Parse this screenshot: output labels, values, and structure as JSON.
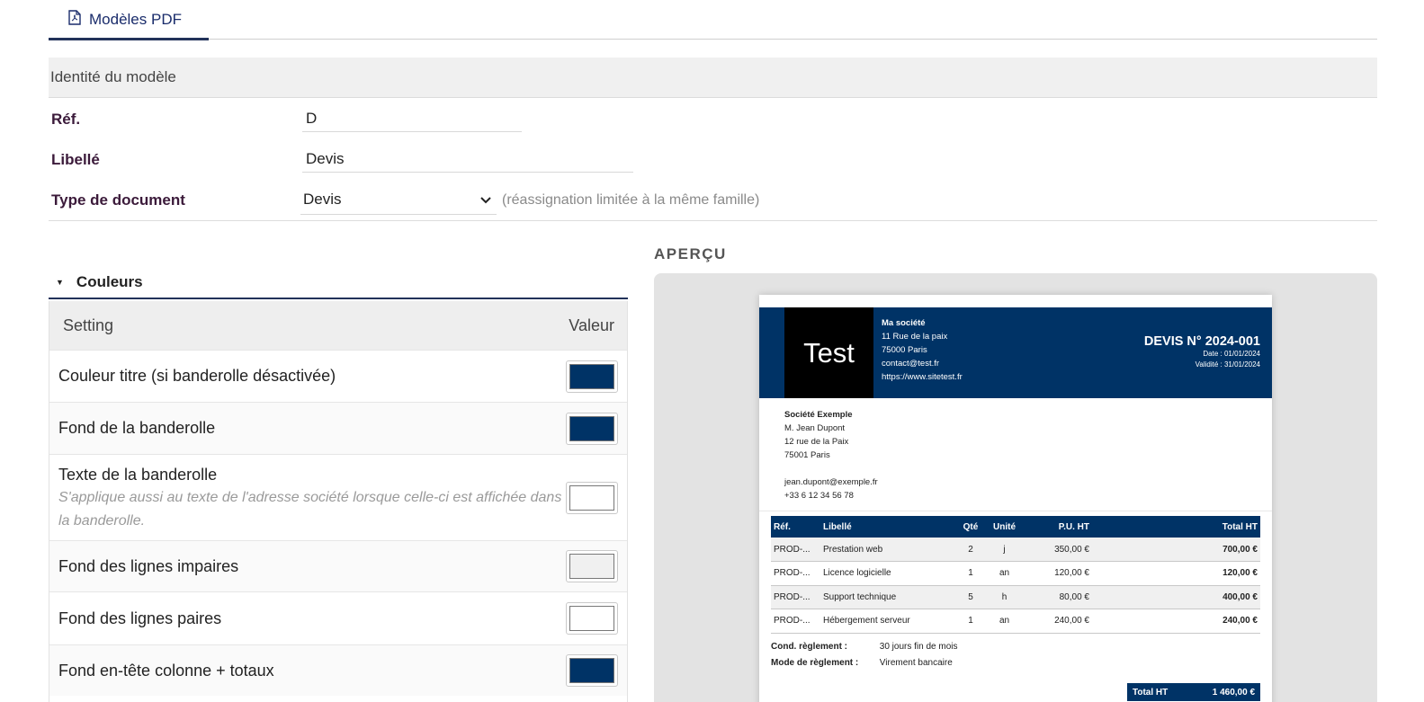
{
  "tabs": [
    {
      "label": "Modèles PDF",
      "icon": "pdf-file-icon",
      "active": true
    }
  ],
  "identity": {
    "title": "Identité du modèle",
    "ref_label": "Réf.",
    "ref_value": "D",
    "libelle_label": "Libellé",
    "libelle_value": "Devis",
    "type_label": "Type de document",
    "type_value": "Devis",
    "type_hint": "(réassignation limitée à la même famille)"
  },
  "colors": {
    "title": "Couleurs",
    "col_setting": "Setting",
    "col_value": "Valeur",
    "rows": [
      {
        "label": "Couleur titre (si banderolle désactivée)",
        "color": "#003366"
      },
      {
        "label": "Fond de la banderolle",
        "color": "#003366"
      },
      {
        "label": "Texte de la banderolle",
        "desc": "S'applique aussi au texte de l'adresse société lorsque celle-ci est affichée dans la banderolle.",
        "color": "#ffffff"
      },
      {
        "label": "Fond des lignes impaires",
        "color": "#f0f0f0"
      },
      {
        "label": "Fond des lignes paires",
        "color": "#ffffff"
      },
      {
        "label": "Fond en-tête colonne + totaux",
        "color": "#003366"
      }
    ]
  },
  "preview": {
    "title": "APERÇU",
    "logo_text": "Test",
    "company": {
      "name": "Ma société",
      "street": "11 Rue de la paix",
      "city": "75000 Paris",
      "email": "contact@test.fr",
      "web": "https://www.sitetest.fr"
    },
    "doc_title": "DEVIS N° 2024-001",
    "doc_date": "Date : 01/01/2024",
    "doc_validity": "Validité : 31/01/2024",
    "client": {
      "company": "Société Exemple",
      "person": "M. Jean Dupont",
      "street": "12 rue de la Paix",
      "city": "75001 Paris",
      "email": "jean.dupont@exemple.fr",
      "phone": "+33 6 12 34 56 78"
    },
    "table": {
      "headers": {
        "ref": "Réf.",
        "label": "Libellé",
        "qty": "Qté",
        "unit": "Unité",
        "pu": "P.U. HT",
        "total": "Total HT"
      },
      "rows": [
        {
          "ref": "PROD-...",
          "label": "Prestation web",
          "qty": "2",
          "unit": "j",
          "pu": "350,00 €",
          "total": "700,00 €"
        },
        {
          "ref": "PROD-...",
          "label": "Licence logicielle",
          "qty": "1",
          "unit": "an",
          "pu": "120,00 €",
          "total": "120,00 €"
        },
        {
          "ref": "PROD-...",
          "label": "Support technique",
          "qty": "5",
          "unit": "h",
          "pu": "80,00 €",
          "total": "400,00 €"
        },
        {
          "ref": "PROD-...",
          "label": "Hébergement serveur",
          "qty": "1",
          "unit": "an",
          "pu": "240,00 €",
          "total": "240,00 €"
        }
      ]
    },
    "cond_label": "Cond. règlement :",
    "cond_value": "30 jours fin de mois",
    "mode_label": "Mode de règlement :",
    "mode_value": "Virement bancaire",
    "total_label": "Total HT",
    "total_value": "1 460,00 €"
  }
}
